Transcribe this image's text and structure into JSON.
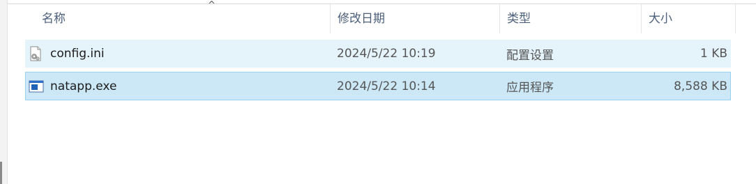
{
  "columns": {
    "name": "名称",
    "date_modified": "修改日期",
    "type": "类型",
    "size": "大小"
  },
  "sort": {
    "column": "name",
    "indicator": "^"
  },
  "files": [
    {
      "name": "config.ini",
      "date_modified": "2024/5/22 10:19",
      "type": "配置设置",
      "size": "1 KB",
      "icon": "settings-file-icon",
      "state": "hover"
    },
    {
      "name": "natapp.exe",
      "date_modified": "2024/5/22 10:14",
      "type": "应用程序",
      "size": "8,588 KB",
      "icon": "application-icon",
      "state": "selected"
    }
  ],
  "colors": {
    "hover_background": "#e5f3fb",
    "selected_background": "#cce8f7",
    "selected_border": "#99d1ef",
    "header_text": "#4c607a"
  }
}
